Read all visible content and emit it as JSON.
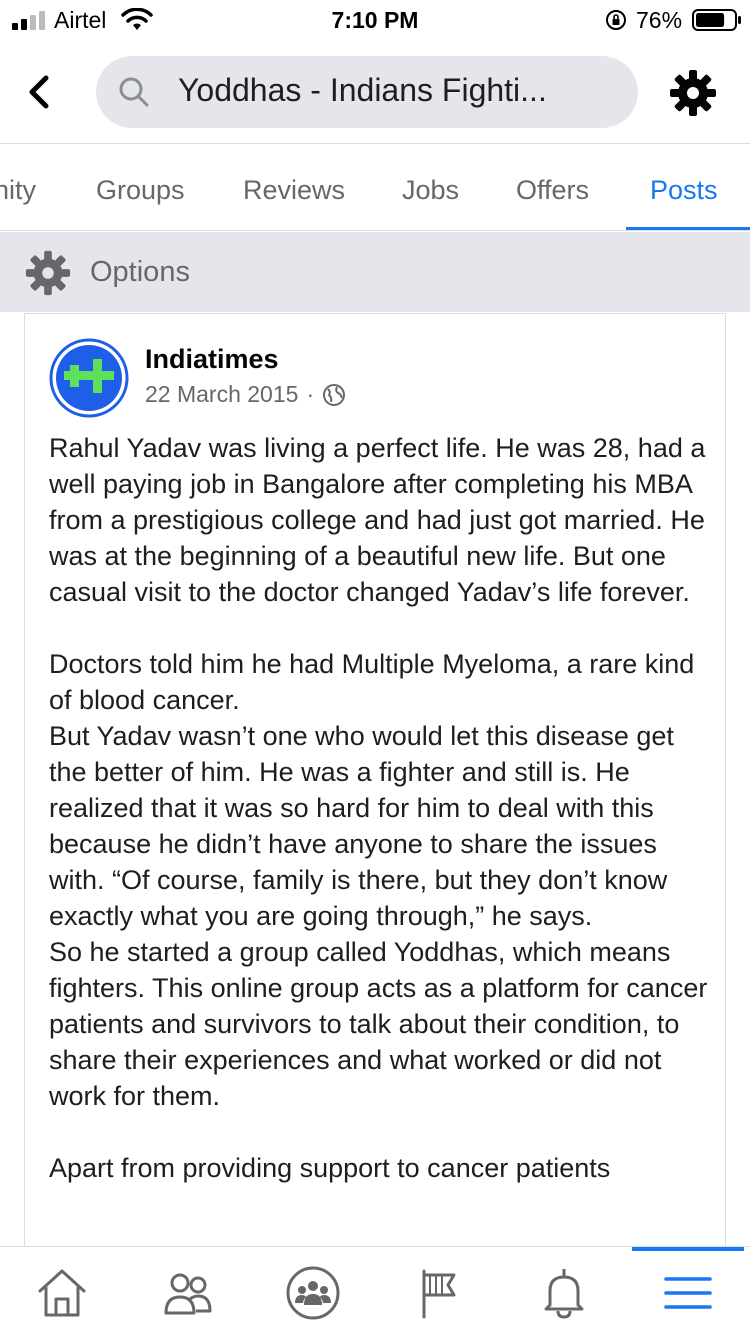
{
  "status_bar": {
    "carrier": "Airtel",
    "time": "7:10 PM",
    "battery_percent": "76%",
    "battery_level": 0.76
  },
  "header": {
    "search_text": "Yoddhas - Indians Fighti...",
    "back_icon": "chevron-left-icon",
    "search_icon": "search-icon",
    "settings_icon": "gear-icon"
  },
  "tabs": [
    {
      "label": "nity"
    },
    {
      "label": "Groups"
    },
    {
      "label": "Reviews"
    },
    {
      "label": "Jobs"
    },
    {
      "label": "Offers"
    },
    {
      "label": "Posts",
      "active": true
    }
  ],
  "options": {
    "label": "Options"
  },
  "post": {
    "author": "Indiatimes",
    "date": "22 March 2015",
    "meta_separator": "·",
    "paragraphs": [
      "Rahul Yadav was living a perfect life. He was 28, had a well paying job in Bangalore after completing his MBA from a prestigious college and had just got married. He was at the beginning of a beautiful new life. But one casual visit to the doctor changed Yadav’s life forever.",
      "Doctors told him he had Multiple Myeloma, a rare kind of blood cancer.\nBut Yadav wasn’t one who would let this disease get the better of him. He was a fighter and still is. He realized that it was so hard for him to deal with this because he didn’t have anyone to share the issues with. “Of course, family is there, but they don’t know exactly what you are going through,” he says.\nSo he started a group called Yoddhas, which means fighters. This online group acts as a platform for cancer patients and survivors to talk about their condition, to share their experiences and what worked or did not work for them.",
      "Apart from providing support to cancer patients"
    ]
  },
  "bottom_nav": [
    {
      "icon": "home-icon"
    },
    {
      "icon": "friends-icon"
    },
    {
      "icon": "groups-icon"
    },
    {
      "icon": "pages-flag-icon"
    },
    {
      "icon": "notifications-bell-icon"
    },
    {
      "icon": "menu-icon",
      "active": true
    }
  ],
  "colors": {
    "accent": "#1877f2",
    "text_primary": "#1c1e21",
    "text_secondary": "#65676b",
    "pill_bg": "#e4e6eb",
    "avatar_blue": "#1f5ee6",
    "avatar_green": "#5ee05a"
  }
}
